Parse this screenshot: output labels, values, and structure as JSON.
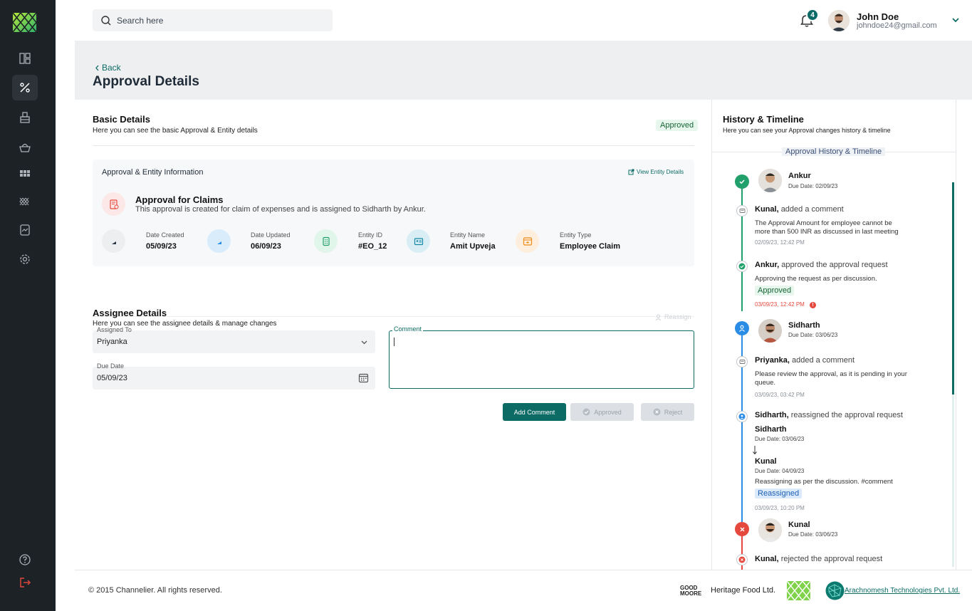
{
  "search": {
    "placeholder": "Search here"
  },
  "notifications": {
    "count": "4"
  },
  "user": {
    "name": "John Doe",
    "email": "johndoe24@gmail.com"
  },
  "page": {
    "back_label": "Back",
    "title": "Approval Details"
  },
  "basic": {
    "title": "Basic Details",
    "subtitle": "Here you can see the basic Approval & Entity details",
    "status": "Approved",
    "info_title": "Approval & Entity Information",
    "view_entity": "View Entity Details",
    "claim_title": "Approval for Claims",
    "claim_desc": "This approval is created for claim of expenses and is assigned to Sidharth by Ankur.",
    "meta": [
      {
        "label": "Date Created",
        "value": "05/09/23"
      },
      {
        "label": "Date Updated",
        "value": "06/09/23"
      },
      {
        "label": "Entity ID",
        "value": "#EO_12"
      },
      {
        "label": "Entity Name",
        "value": "Amit Upveja"
      },
      {
        "label": "Entity Type",
        "value": "Employee Claim"
      }
    ]
  },
  "assignee": {
    "title": "Assignee Details",
    "subtitle": "Here you can see the assignee details & manage changes",
    "reassign": "Reassign",
    "assigned_label": "Assigned To",
    "assigned_value": "Priyanka",
    "due_label": "Due Date",
    "due_value": "05/09/23",
    "comment_label": "Comment",
    "btn_add": "Add Comment",
    "btn_approved": "Approved",
    "btn_reject": "Reject"
  },
  "history": {
    "title": "History & Timeline",
    "subtitle": "Here you can see your Approval changes history & timeline",
    "pill": "Approval History & Timeline",
    "items": [
      {
        "name": "Ankur",
        "due": "Due Date: 02/09/23"
      },
      {
        "actor": "Kunal,",
        "action": "added a comment",
        "text": "The Approval Amount for employee cannot be more than 500 INR as discussed in last meeting",
        "time": "02/09/23, 12:42 PM"
      },
      {
        "actor": "Ankur,",
        "action": "approved the approval request",
        "text": "Approving the request as per discussion.",
        "tag": "Approved",
        "time": "03/09/23, 12:42 PM"
      },
      {
        "name": "Sidharth",
        "due": "Due Date: 03/06/23"
      },
      {
        "actor": "Priyanka,",
        "action": "added a comment",
        "text": "Please review the approval, as it is pending in your queue.",
        "time": "03/09/23, 03:42 PM"
      },
      {
        "actor": "Sidharth,",
        "action": "reassigned the approval request",
        "from_name": "Sidharth",
        "from_due": "Due Date: 03/06/23",
        "to_name": "Kunal",
        "to_due": "Due Date: 04/09/23",
        "text": "Reassigning as per the discussion. #comment",
        "tag": "Reassigned",
        "time": "03/09/23, 10:20 PM"
      },
      {
        "name": "Kunal",
        "due": "Due Date: 03/06/23"
      },
      {
        "actor": "Kunal,",
        "action": "rejected the approval request"
      }
    ]
  },
  "footer": {
    "copyright": "© 2015 Channelier. All rights reserved.",
    "brand1": "GOOD MOORE",
    "brand2": "Heritage Food Ltd.",
    "brand3": "Arachnomesh Technologies Pvt. Ltd."
  },
  "colors": {
    "primary": "#0d6b66",
    "sidebar": "#1c2226",
    "success": "#22a06b",
    "info": "#2b8ce6",
    "danger": "#e5483c"
  }
}
